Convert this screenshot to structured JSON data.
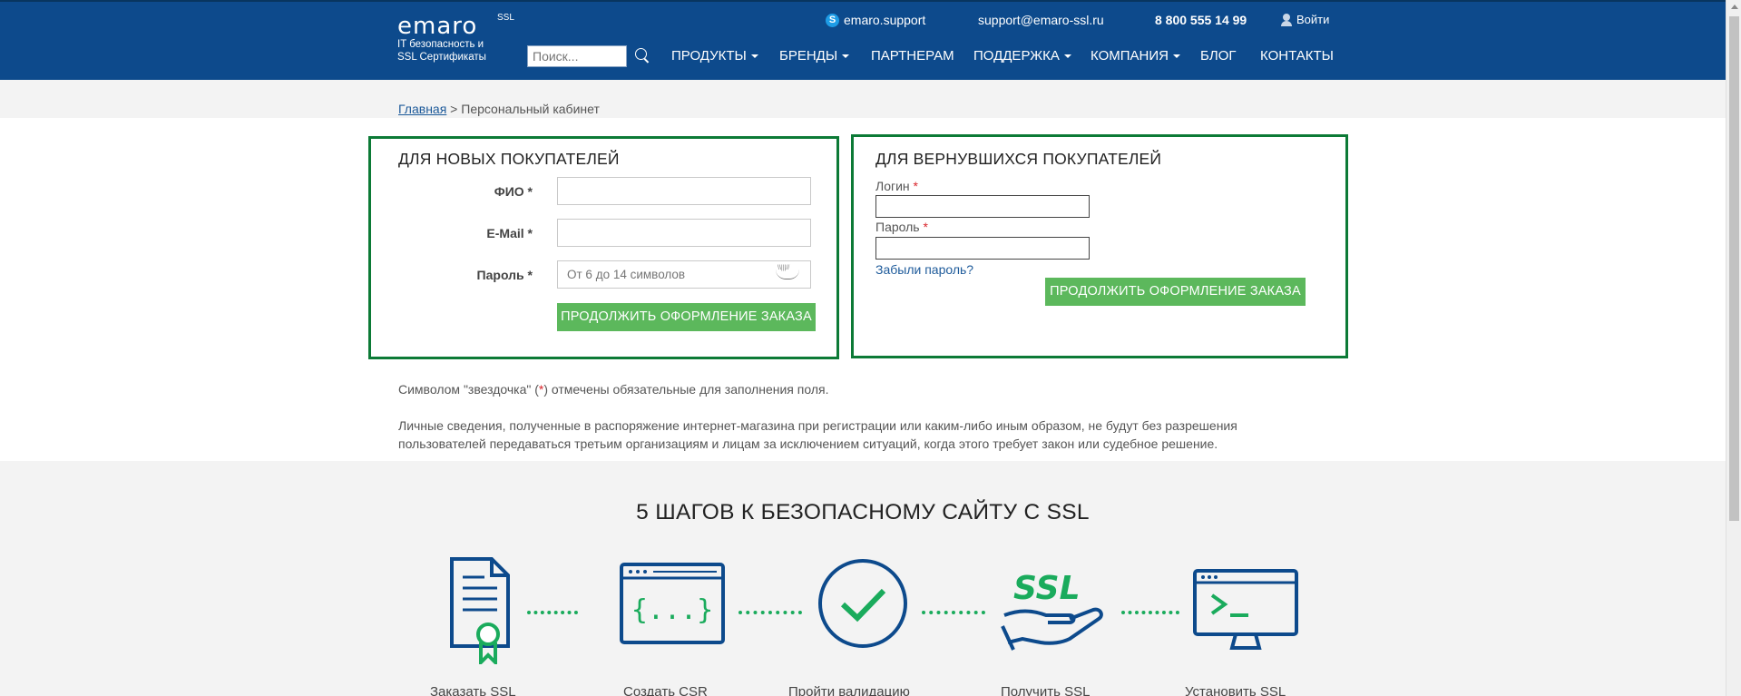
{
  "header": {
    "logo_word": "emaro",
    "logo_ssl": "SSL",
    "logo_tagline_1": "IT безопасность и",
    "logo_tagline_2": "SSL Сертификаты",
    "skype": "emaro.support",
    "email": "support@emaro-ssl.ru",
    "phone": "8 800 555 14 99",
    "login": "Войти",
    "search_placeholder": "Поиск...",
    "nav": [
      {
        "label": "ПРОДУКТЫ",
        "dropdown": true
      },
      {
        "label": "БРЕНДЫ",
        "dropdown": true
      },
      {
        "label": "ПАРТНЕРАМ",
        "dropdown": false
      },
      {
        "label": "ПОДДЕРЖКА",
        "dropdown": true
      },
      {
        "label": "КОМПАНИЯ",
        "dropdown": true
      },
      {
        "label": "БЛОГ",
        "dropdown": false
      },
      {
        "label": "КОНТАКТЫ",
        "dropdown": false
      }
    ]
  },
  "breadcrumb": {
    "home": "Главная",
    "separator": " > ",
    "current": "Персональный кабинет"
  },
  "new_customers": {
    "title": "ДЛЯ НОВЫХ ПОКУПАТЕЛЕЙ",
    "fio_label": "ФИО *",
    "email_label": "E-Mail *",
    "password_label": "Пароль *",
    "password_placeholder": "От 6 до 14 символов",
    "submit": "ПРОДОЛЖИТЬ ОФОРМЛЕНИЕ ЗАКАЗА"
  },
  "returning_customers": {
    "title": "ДЛЯ ВЕРНУВШИХСЯ ПОКУПАТЕЛЕЙ",
    "login_label": "Логин",
    "password_label": "Пароль",
    "required_mark": "*",
    "forgot": "Забыли пароль?",
    "submit": "ПРОДОЛЖИТЬ ОФОРМЛЕНИЕ ЗАКАЗА"
  },
  "notes": {
    "required_prefix": "Символом \"звездочка\" (",
    "required_star": "*",
    "required_suffix": ") отмечены обязательные для заполнения поля.",
    "privacy_1": "Личные сведения, полученные в распоряжение интернет-магазина при регистрации или каким-либо иным образом, не будут без разрешения",
    "privacy_2": "пользователей передаваться третьим организациям и лицам за исключением ситуаций, когда этого требует закон или судебное решение."
  },
  "steps": {
    "title": "5 ШАГОВ К БЕЗОПАСНОМУ САЙТУ С SSL",
    "items": [
      {
        "label": "Заказать SSL",
        "icon": "certificate-icon"
      },
      {
        "label": "Создать CSR",
        "icon": "code-window-icon"
      },
      {
        "label": "Пройти валидацию",
        "icon": "checkmark-circle-icon"
      },
      {
        "label": "Получить SSL",
        "icon": "ssl-hand-icon",
        "icon_text": "SSL"
      },
      {
        "label": "Установить SSL",
        "icon": "monitor-terminal-icon"
      }
    ]
  },
  "colors": {
    "header_bg": "#0d4a8c",
    "panel_border": "#0c7a36",
    "button": "#5cb85c",
    "icon_blue": "#0d4a8c",
    "icon_green": "#1aab5c",
    "required": "#d9252b"
  }
}
